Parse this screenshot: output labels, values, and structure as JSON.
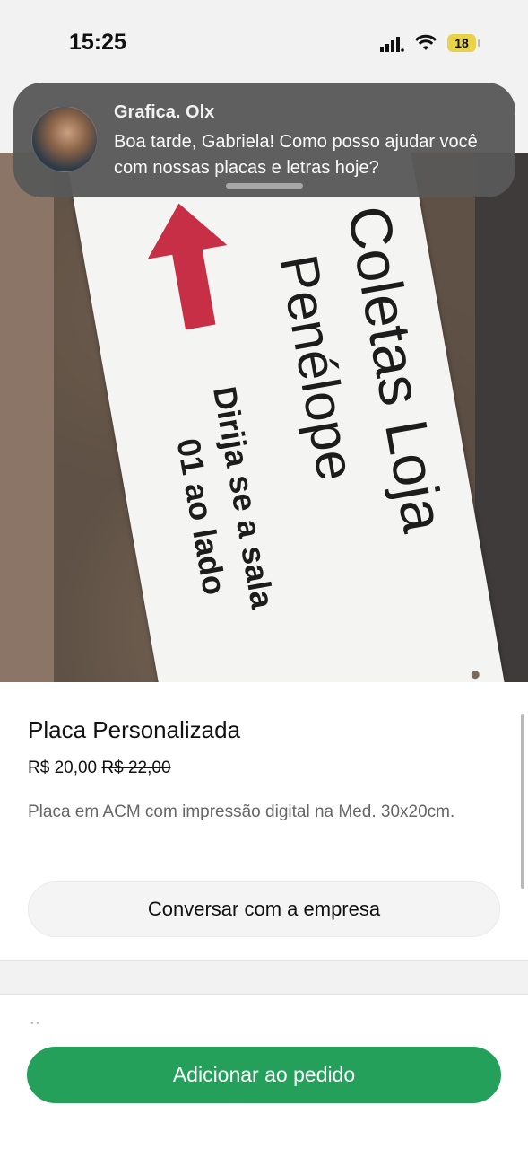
{
  "status_bar": {
    "time": "15:25",
    "battery": "18",
    "icons": [
      "cellular-signal-icon",
      "wifi-icon",
      "battery-icon"
    ]
  },
  "notification": {
    "sender": "Grafica. Olx",
    "message": "Boa tarde, Gabriela! Como posso ajudar você com nossas placas e letras hoje?"
  },
  "photo": {
    "sign_lines": [
      "Coletas Loja",
      "Penélope",
      "Dirija se a sala",
      "01 ao lado"
    ],
    "arrow_color": "#c62f45"
  },
  "product": {
    "title": "Placa Personalizada",
    "price": "R$ 20,00",
    "old_price": "R$ 22,00",
    "description": "Placa em ACM com impressão digital na Med. 30x20cm."
  },
  "actions": {
    "chat_label": "Conversar com a empresa",
    "add_label": "Adicionar ao pedido"
  },
  "colors": {
    "primary_button": "#25a05a",
    "notification_bg": "#585858"
  }
}
